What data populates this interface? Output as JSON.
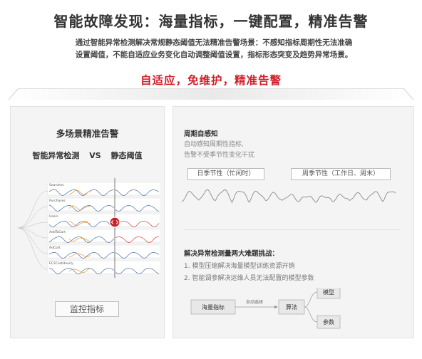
{
  "hero": {
    "title": "智能故障发现：海量指标，一键配置，精准告警",
    "desc_line1": "通过智能异常检测解决常规静态阈值无法精准告警场景：不感知指标周期性无法准确",
    "desc_line2": "设置阈值，不能自适应业务变化自动调整阈值设置，指标形态突变及趋势异常场景。",
    "slogan": "自适应，免维护，精准告警"
  },
  "left_panel": {
    "title": "多场景精准告警",
    "compare_left": "智能异常检测",
    "compare_vs": "VS",
    "compare_right": "静态阈值",
    "metrics": [
      "Searches",
      "Purchases",
      "Users",
      "AddToCart",
      "AdCost",
      "EC2CostHourly"
    ],
    "button_label": "监控指标"
  },
  "right_panel": {
    "period_heading": "周期自感知",
    "period_text1": "自动感知周期性指标,",
    "period_text2": "告警不受季节性变化干扰",
    "tag_season": "日季节性（忙闲时）",
    "tag_week": "周季节性（工作日、周末）",
    "challenge_heading": "解决异常检测量两大难题挑战：",
    "challenge_1": "1. 模型压缩解决海量模型训练资源开销",
    "challenge_2": "2. 智能调参解决运维人员无法配置的模型参数",
    "flow": {
      "input": "海量指标",
      "edge_label": "自动选择",
      "algo": "算法",
      "model": "模型",
      "params": "参数"
    }
  },
  "colors": {
    "accent_red": "#d01f28",
    "wave_gray": "#8a8a8a",
    "chart_blue": "#4a6fa5",
    "chart_orange": "#e8942a"
  }
}
